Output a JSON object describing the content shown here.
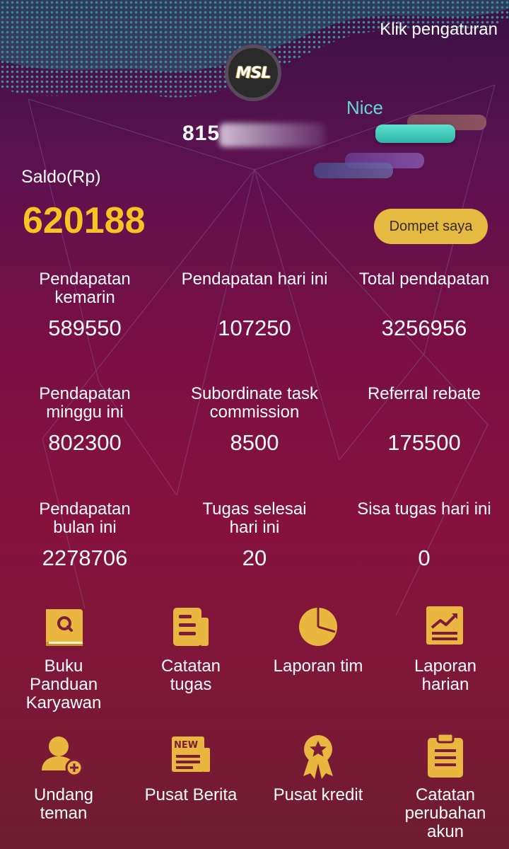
{
  "header": {
    "settings_link": "Klik pengaturan",
    "logo_text": "MSL",
    "level": "Nice",
    "username_visible": "815"
  },
  "balance": {
    "label": "Saldo(Rp)",
    "value": "620188",
    "wallet_button": "Dompet saya"
  },
  "stats": [
    {
      "label": "Pendapatan kemarin",
      "value": "589550"
    },
    {
      "label": "Pendapatan hari ini",
      "value": "107250"
    },
    {
      "label": "Total pendapatan",
      "value": "3256956"
    },
    {
      "label": "Pendapatan minggu ini",
      "value": "802300"
    },
    {
      "label": "Subordinate task commission",
      "value": "8500"
    },
    {
      "label": "Referral rebate",
      "value": "175500"
    },
    {
      "label": "Pendapatan bulan ini",
      "value": "2278706"
    },
    {
      "label": "Tugas selesai hari ini",
      "value": "20"
    },
    {
      "label": "Sisa tugas hari ini",
      "value": "0"
    }
  ],
  "menu": [
    {
      "label": "Buku Panduan Karyawan",
      "icon": "guide-book-icon"
    },
    {
      "label": "Catatan tugas",
      "icon": "task-record-icon"
    },
    {
      "label": "Laporan tim",
      "icon": "pie-chart-icon"
    },
    {
      "label": "Laporan harian",
      "icon": "trend-chart-icon"
    },
    {
      "label": "Undang teman",
      "icon": "add-user-icon"
    },
    {
      "label": "Pusat Berita",
      "icon": "newspaper-icon",
      "badge": "NEW"
    },
    {
      "label": "Pusat kredit",
      "icon": "medal-icon"
    },
    {
      "label": "Catatan perubahan akun",
      "icon": "clipboard-icon"
    }
  ],
  "colors": {
    "accent_gold": "#f5c623",
    "icon_gold": "#e9b640",
    "level_teal": "#64d8cc",
    "wallet_button_bg": "#e4ba40"
  }
}
